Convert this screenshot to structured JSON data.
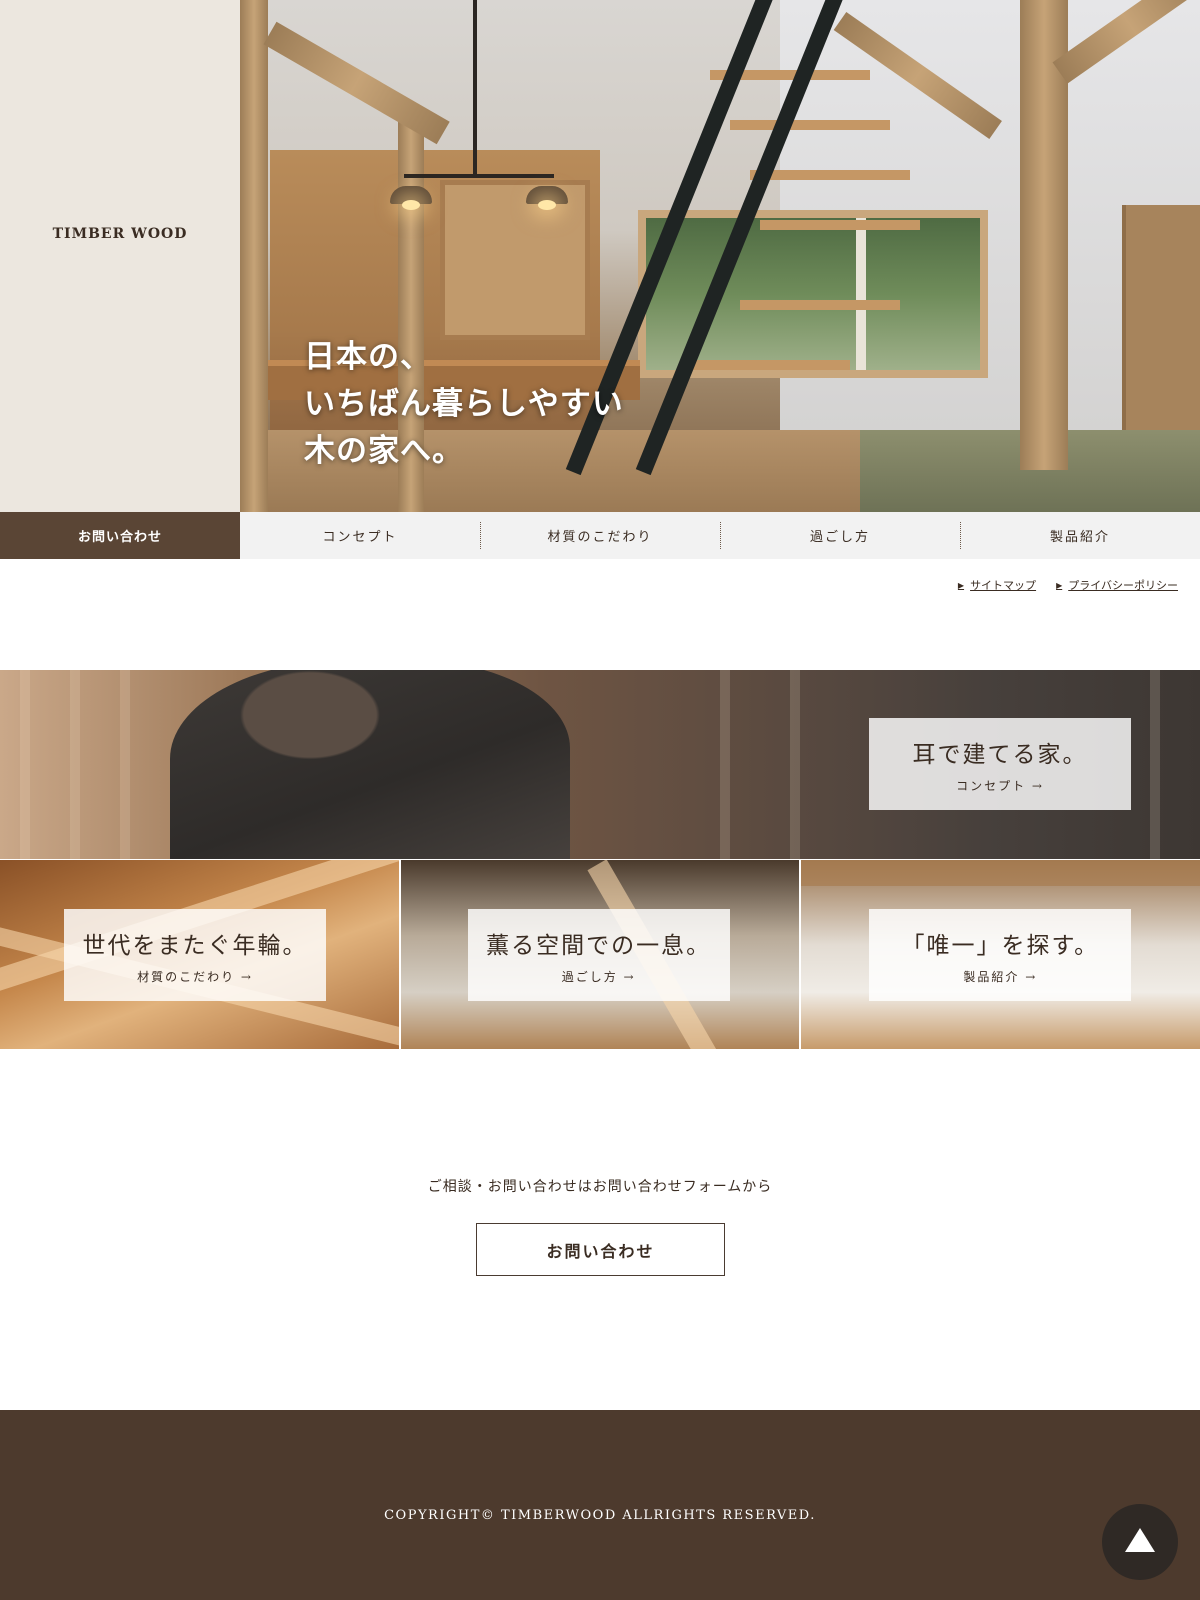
{
  "brand": {
    "logo": "TIMBER WOOD"
  },
  "hero": {
    "lines": [
      "日本の、",
      "いちばん暮らしやすい",
      "木の家へ。"
    ]
  },
  "nav": {
    "contact_label": "お問い合わせ",
    "items": [
      {
        "label": "コンセプト"
      },
      {
        "label": "材質のこだわり"
      },
      {
        "label": "過ごし方"
      },
      {
        "label": "製品紹介"
      }
    ]
  },
  "utility_links": [
    {
      "label": "サイトマップ",
      "icon": "triangle-right-icon"
    },
    {
      "label": "プライバシーポリシー",
      "icon": "triangle-right-icon"
    }
  ],
  "features": {
    "wide": {
      "title": "耳で建てる家。",
      "link": "コンセプト →"
    },
    "cards": [
      {
        "title": "世代をまたぐ年輪。",
        "link": "材質のこだわり →"
      },
      {
        "title": "薫る空間での一息。",
        "link": "過ごし方 →"
      },
      {
        "title": "「唯一」を探す。",
        "link": "製品紹介 →"
      }
    ]
  },
  "contact": {
    "lead": "ご相談・お問い合わせはお問い合わせフォームから",
    "button": "お問い合わせ"
  },
  "footer": {
    "copyright": "COPYRIGHT© TIMBERWOOD ALLRIGHTS RESERVED."
  },
  "page_top": {
    "icon": "arrow-up-triangle-icon"
  },
  "colors": {
    "brand_brown": "#5a4535",
    "footer_brown": "#4d3a2d",
    "nav_bg": "#f2f2f2",
    "brand_panel_bg": "#ece7df"
  }
}
